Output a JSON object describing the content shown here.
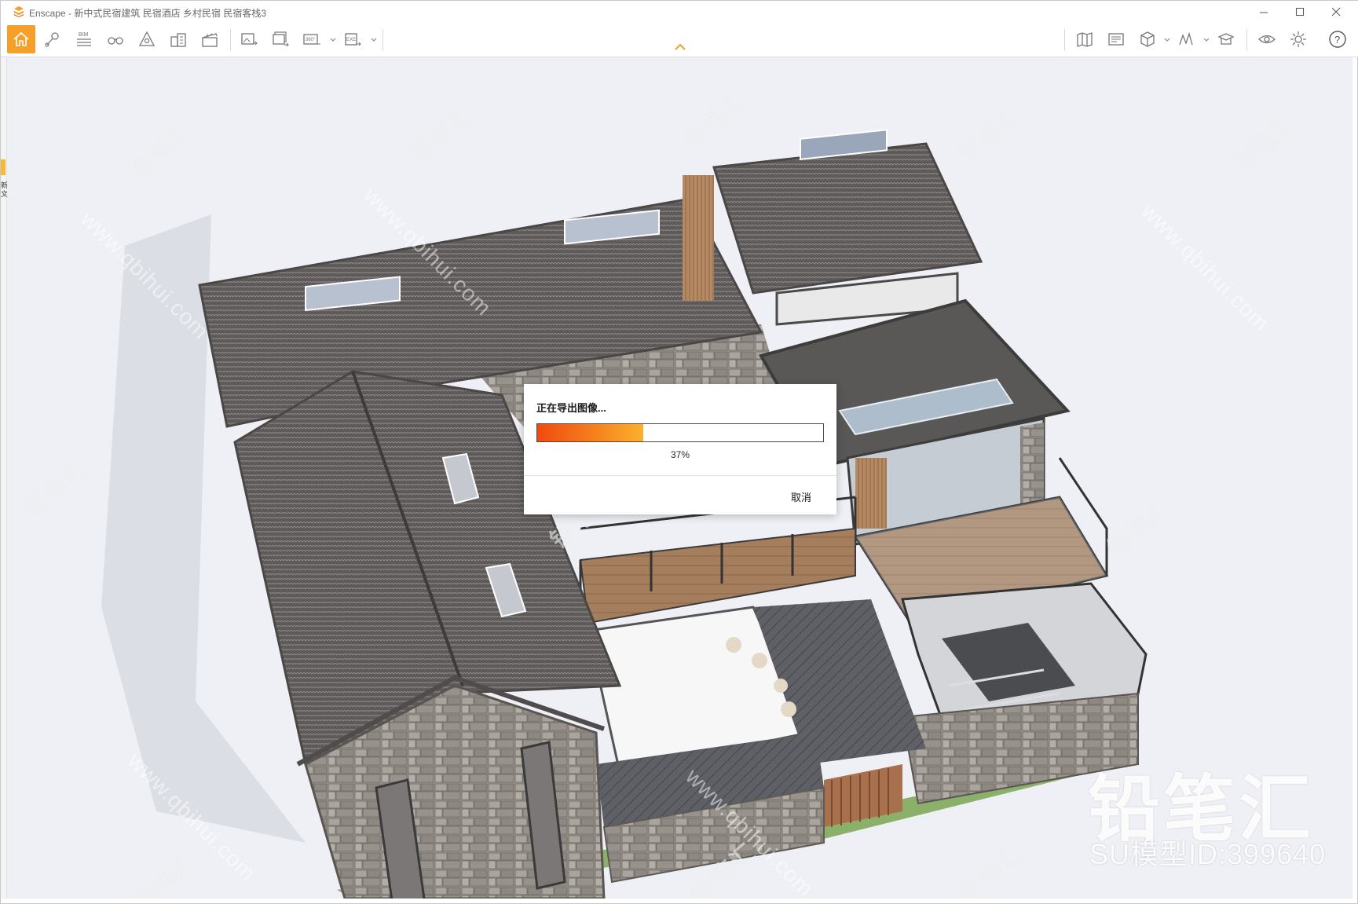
{
  "window": {
    "title": "Enscape - 新中式民宿建筑 民宿酒店 乡村民宿 民宿客栈3"
  },
  "toolbar": {
    "left_icons": [
      "home-icon",
      "location-icon",
      "bim-icon",
      "binoculars-icon",
      "safe-frame-icon",
      "buildings-icon",
      "clapper-icon",
      "render-image-icon",
      "batch-render-icon",
      "panorama-360-icon",
      "exe-export-icon"
    ],
    "bim_label": "BIM",
    "pano_label": "360°",
    "exe_label": "EXE",
    "right_icons": [
      "map-icon",
      "views-icon",
      "cube-icon",
      "material-icon",
      "asset-library-icon",
      "visual-settings-icon",
      "settings-icon",
      "help-icon"
    ],
    "help_label": "?"
  },
  "dialog": {
    "title": "正在导出图像...",
    "progress": 0.37,
    "progress_text": "37%",
    "cancel_label": "取消"
  },
  "side_panel": {
    "label": "新文"
  },
  "watermark": {
    "brand": "铅笔汇",
    "model_id": "SU模型ID:399640",
    "tag": "铅笔汇",
    "url": "www.qbihui.com"
  },
  "colors": {
    "accent": "#f5a02b",
    "progress_start": "#f04a10",
    "progress_end": "#fbb12f",
    "roof": "#5a5756",
    "stone": "#8f8b86",
    "deck": "#a07a5a",
    "ground": "#eef0f6"
  }
}
